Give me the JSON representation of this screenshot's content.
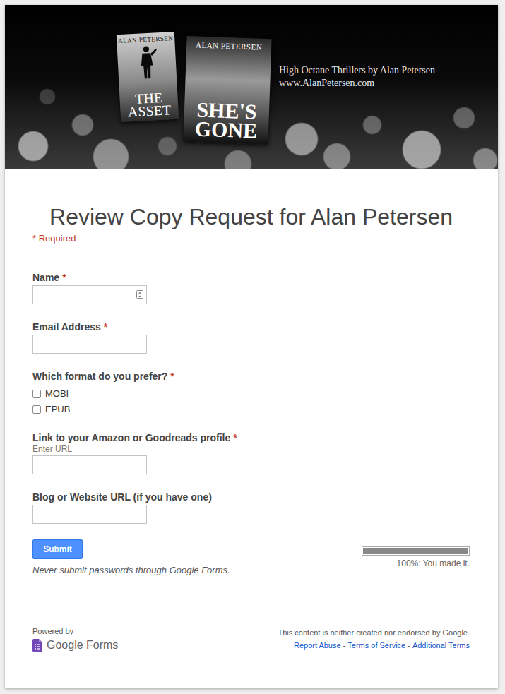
{
  "banner": {
    "books": [
      {
        "author": "ALAN PETERSEN",
        "title": "THE ASSET"
      },
      {
        "author": "ALAN PETERSEN",
        "title": "SHE'S GONE"
      }
    ],
    "tagline": "High Octane Thrillers by Alan Petersen",
    "url": "www.AlanPetersen.com"
  },
  "form": {
    "title": "Review Copy Request for Alan Petersen",
    "required_note": "* Required",
    "required_mark": "*",
    "fields": [
      {
        "kind": "text",
        "label": "Name",
        "required": true,
        "help": "",
        "value": "",
        "autofill_icon": true,
        "options": []
      },
      {
        "kind": "text",
        "label": "Email Address",
        "required": true,
        "help": "",
        "value": "",
        "autofill_icon": false,
        "options": []
      },
      {
        "kind": "checkbox",
        "label": "Which format do you prefer?",
        "required": true,
        "help": "",
        "value": "",
        "autofill_icon": false,
        "options": [
          {
            "label": "MOBI",
            "checked": false
          },
          {
            "label": "EPUB",
            "checked": false
          }
        ]
      },
      {
        "kind": "text",
        "label": "Link to your Amazon or Goodreads profile",
        "required": true,
        "help": "Enter URL",
        "value": "",
        "autofill_icon": false,
        "options": []
      },
      {
        "kind": "text",
        "label": "Blog or Website URL (if you have one)",
        "required": false,
        "help": "",
        "value": "",
        "autofill_icon": false,
        "options": []
      }
    ]
  },
  "submit": "Submit",
  "password_warning": "Never submit passwords through Google Forms.",
  "progress": {
    "level": 1,
    "label": "100%: You made it."
  },
  "footer": {
    "powered_by": "Powered by",
    "logo": "Google Forms",
    "disclaimer": "This content is neither created nor endorsed by Google.",
    "links": [
      "Report Abuse",
      "Terms of Service",
      "Additional Terms"
    ],
    "separator": "-"
  }
}
